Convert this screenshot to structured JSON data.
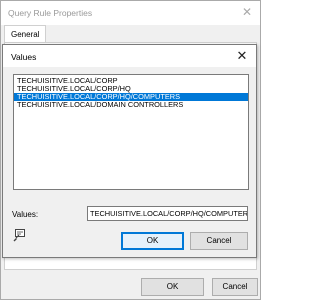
{
  "outer_window": {
    "title": "Query Rule Properties",
    "close_glyph": "✕",
    "tab_general": "General",
    "ok_label": "OK",
    "cancel_label": "Cancel"
  },
  "dialog": {
    "title": "Values",
    "close_glyph": "✕",
    "list_items": [
      {
        "text": "TECHUISITIVE.LOCAL/CORP",
        "selected": false
      },
      {
        "text": "TECHUISITIVE.LOCAL/CORP/HQ",
        "selected": false
      },
      {
        "text": "TECHUISITIVE.LOCAL/CORP/HQ/COMPUTERS",
        "selected": true
      },
      {
        "text": "TECHUISITIVE.LOCAL/DOMAIN CONTROLLERS",
        "selected": false
      }
    ],
    "values_label": "Values:",
    "values_input": "TECHUISITIVE.LOCAL/CORP/HQ/COMPUTERS",
    "ok_label": "OK",
    "cancel_label": "Cancel",
    "edit_icon": "edit-item-icon"
  },
  "colors": {
    "selection": "#0078d7",
    "dialog_bg": "#f0f0f0"
  }
}
